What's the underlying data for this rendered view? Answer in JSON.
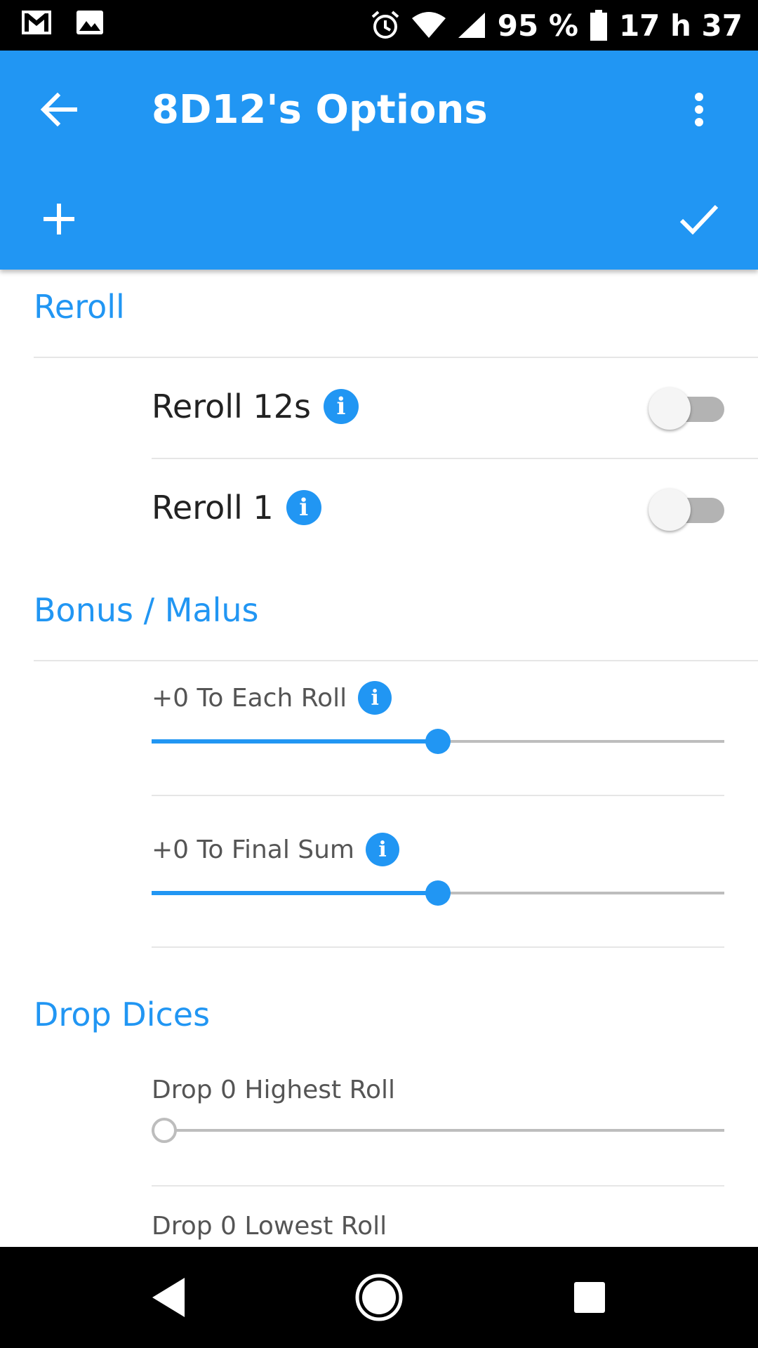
{
  "status_bar": {
    "battery": "95 %",
    "time": "17 h 37",
    "icons": [
      "gmail-icon",
      "gallery-icon",
      "alarm-icon",
      "wifi-icon",
      "signal-icon",
      "battery-icon"
    ]
  },
  "app_bar": {
    "title": "8D12's Options",
    "back_icon": "arrow-left-icon",
    "menu_icon": "more-vert-icon",
    "add_icon": "plus-icon",
    "confirm_icon": "check-icon",
    "color": "#2196F3"
  },
  "sections": {
    "reroll": {
      "title": "Reroll",
      "items": [
        {
          "label": "Reroll 12s",
          "enabled": false
        },
        {
          "label": "Reroll 1",
          "enabled": false
        }
      ]
    },
    "bonus_malus": {
      "title": "Bonus / Malus",
      "sliders": [
        {
          "label": "+0 To Each Roll",
          "value": 0.5
        },
        {
          "label": "+0 To Final Sum",
          "value": 0.5
        }
      ]
    },
    "drop_dices": {
      "title": "Drop Dices",
      "sliders": [
        {
          "label": "Drop 0 Highest Roll",
          "value": 0
        },
        {
          "label": "Drop 0 Lowest Roll",
          "value": 0
        }
      ]
    }
  },
  "info_glyph": "i",
  "nav_bar": {
    "back": "nav-back-icon",
    "home": "nav-home-icon",
    "recents": "nav-recents-icon"
  }
}
